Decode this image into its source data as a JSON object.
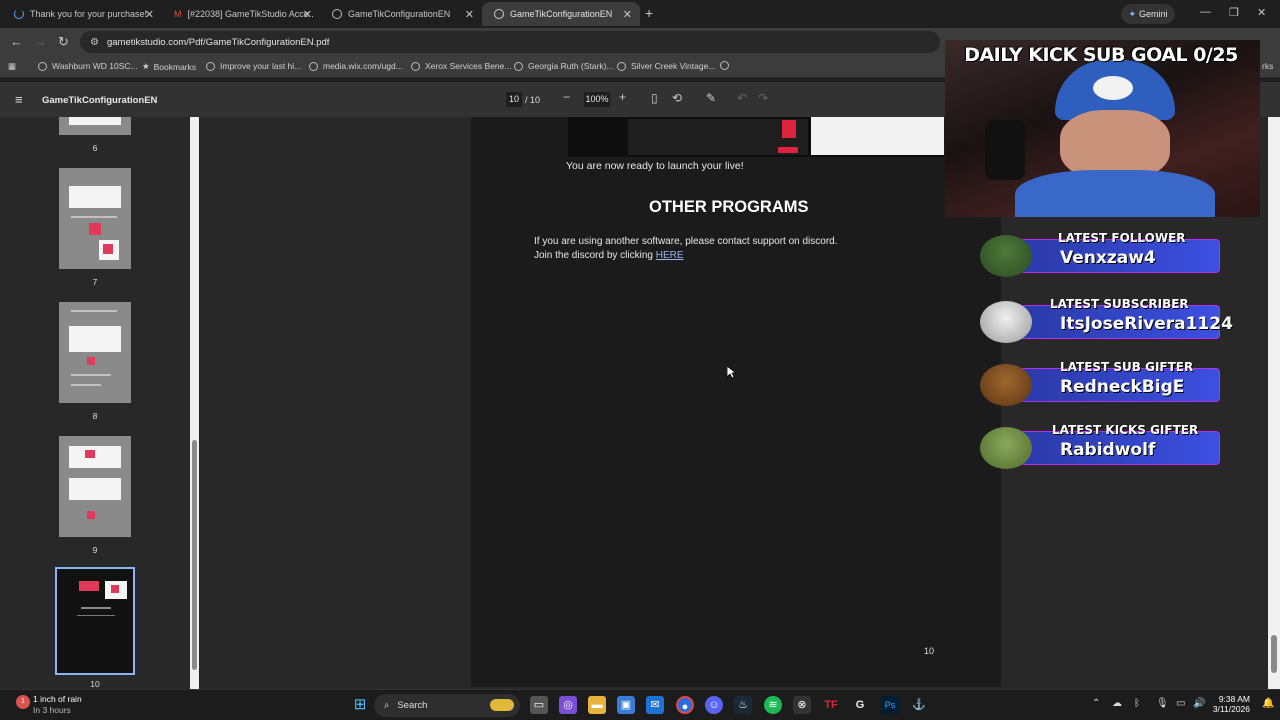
{
  "browser": {
    "tabs": [
      {
        "title": "Thank you for your purchase!",
        "active": false
      },
      {
        "title": "[#22038] GameTikStudio Acce...",
        "active": false
      },
      {
        "title": "GameTikConfigurationEN",
        "active": false
      },
      {
        "title": "GameTikConfigurationEN",
        "active": true
      }
    ],
    "gemini_label": "Gemini",
    "url": "gametikstudio.com/Pdf/GameTikConfigurationEN.pdf",
    "bookmarks": [
      "Washburn WD 10SC...",
      "Bookmarks",
      "Improve your last hi...",
      "media.wix.com/ugd...",
      "Xerox Services Bene...",
      "Georgia Ruth (Stark)...",
      "Silver Creek Vintage..."
    ],
    "bookmarks_overflow": "rks"
  },
  "pdf": {
    "title": "GameTikConfigurationEN",
    "current_page": "10",
    "total_pages": "/ 10",
    "zoom": "100%",
    "thumbnails": [
      {
        "num": "6"
      },
      {
        "num": "7"
      },
      {
        "num": "8"
      },
      {
        "num": "9"
      },
      {
        "num": "10"
      }
    ],
    "content": {
      "ready_text": "You are now ready to launch your live!",
      "heading": "OTHER PROGRAMS",
      "para1": "If you are using another software, please contact support on discord.",
      "para2_prefix": "Join the discord by clicking ",
      "link": "HERE",
      "page_number": "10"
    }
  },
  "overlay": {
    "goal": "DAILY KICK SUB GOAL 0/25",
    "alerts": [
      {
        "label": "LATEST FOLLOWER",
        "value": "Venxzaw4"
      },
      {
        "label": "LATEST SUBSCRIBER",
        "value": "ItsJoseRivera1124"
      },
      {
        "label": "LATEST SUB GIFTER",
        "value": "RedneckBigE"
      },
      {
        "label": "LATEST KICKS GIFTER",
        "value": "Rabidwolf"
      }
    ]
  },
  "taskbar": {
    "weather_line1": "1 inch of rain",
    "weather_line2": "In 3 hours",
    "weather_badge": "1",
    "search_placeholder": "Search",
    "time": "9:38 AM",
    "date": "3/11/2026"
  },
  "colors": {
    "accent": "#8ab4f8",
    "alert_band": "#3c4fe0",
    "alert_border": "#b92ef2"
  }
}
